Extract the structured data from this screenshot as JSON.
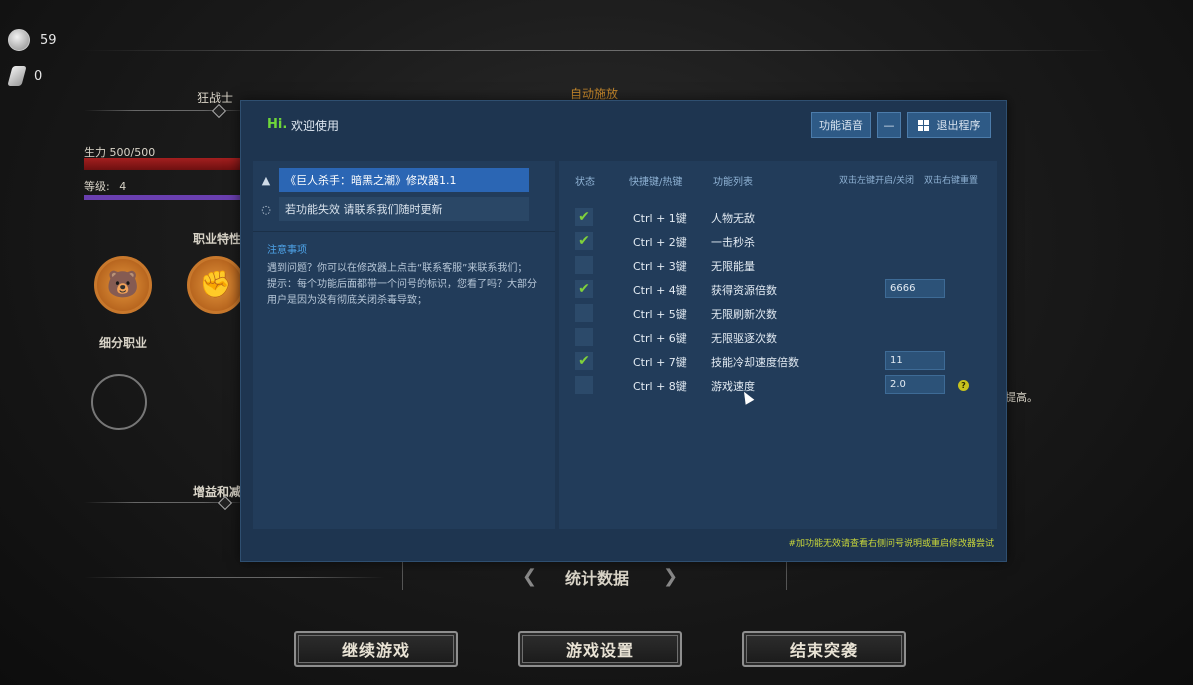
{
  "game": {
    "resources": [
      {
        "icon": "silver-coin-icon",
        "value": "59"
      },
      {
        "icon": "crystal-shard-icon",
        "value": "0"
      }
    ],
    "class_name": "狂战士",
    "top_label": "自动施放",
    "hp": "生力 500/500",
    "level_label": "等级:",
    "level_value": "4",
    "class_traits": "职业特性",
    "subclass": "细分职业",
    "buffs": "增益和减",
    "right_fragment": "提高。",
    "stats_title": "统计数据",
    "buttons": [
      "继续游戏",
      "游戏设置",
      "结束突袭"
    ]
  },
  "trainer": {
    "hi": "Hi.",
    "welcome": "欢迎使用",
    "voice_btn": "功能语音",
    "minimize_btn": "—",
    "exit_btn": "退出程序",
    "menu": [
      {
        "icon": "user-icon",
        "label": "《巨人杀手：暗黑之潮》修改器1.1"
      },
      {
        "icon": "gear-icon",
        "label": "若功能失效 请联系我们随时更新"
      }
    ],
    "notes_title": "注意事项",
    "notes_text": "遇到问题？你可以在修改器上点击“联系客服”来联系我们；提示：每个功能后面都带一个问号的标识，您看了吗？大部分用户是因为没有彻底关闭杀毒导致；",
    "headers": {
      "status": "状态",
      "hotkey": "快捷键/热键",
      "features": "功能列表",
      "toggle_hint": "双击左键开启/关闭",
      "reset_hint": "双击右键重置"
    },
    "rows": [
      {
        "checked": true,
        "hotkey": "Ctrl + 1键",
        "name": "人物无敌"
      },
      {
        "checked": true,
        "hotkey": "Ctrl + 2键",
        "name": "一击秒杀"
      },
      {
        "checked": false,
        "hotkey": "Ctrl + 3键",
        "name": "无限能量"
      },
      {
        "checked": true,
        "hotkey": "Ctrl + 4键",
        "name": "获得资源倍数",
        "value": "6666"
      },
      {
        "checked": false,
        "hotkey": "Ctrl + 5键",
        "name": "无限刷新次数"
      },
      {
        "checked": false,
        "hotkey": "Ctrl + 6键",
        "name": "无限驱逐次数"
      },
      {
        "checked": true,
        "hotkey": "Ctrl + 7键",
        "name": "技能冷却速度倍数",
        "value": "11"
      },
      {
        "checked": false,
        "hotkey": "Ctrl + 8键",
        "name": "游戏速度",
        "value": "2.0",
        "help": "?"
      }
    ],
    "footer": "#加功能无效请查看右侧问号说明或重启修改器尝试",
    "colors": {
      "accent": "#6ed63a",
      "panel": "#1e3550",
      "selected": "#2b66b4"
    }
  }
}
